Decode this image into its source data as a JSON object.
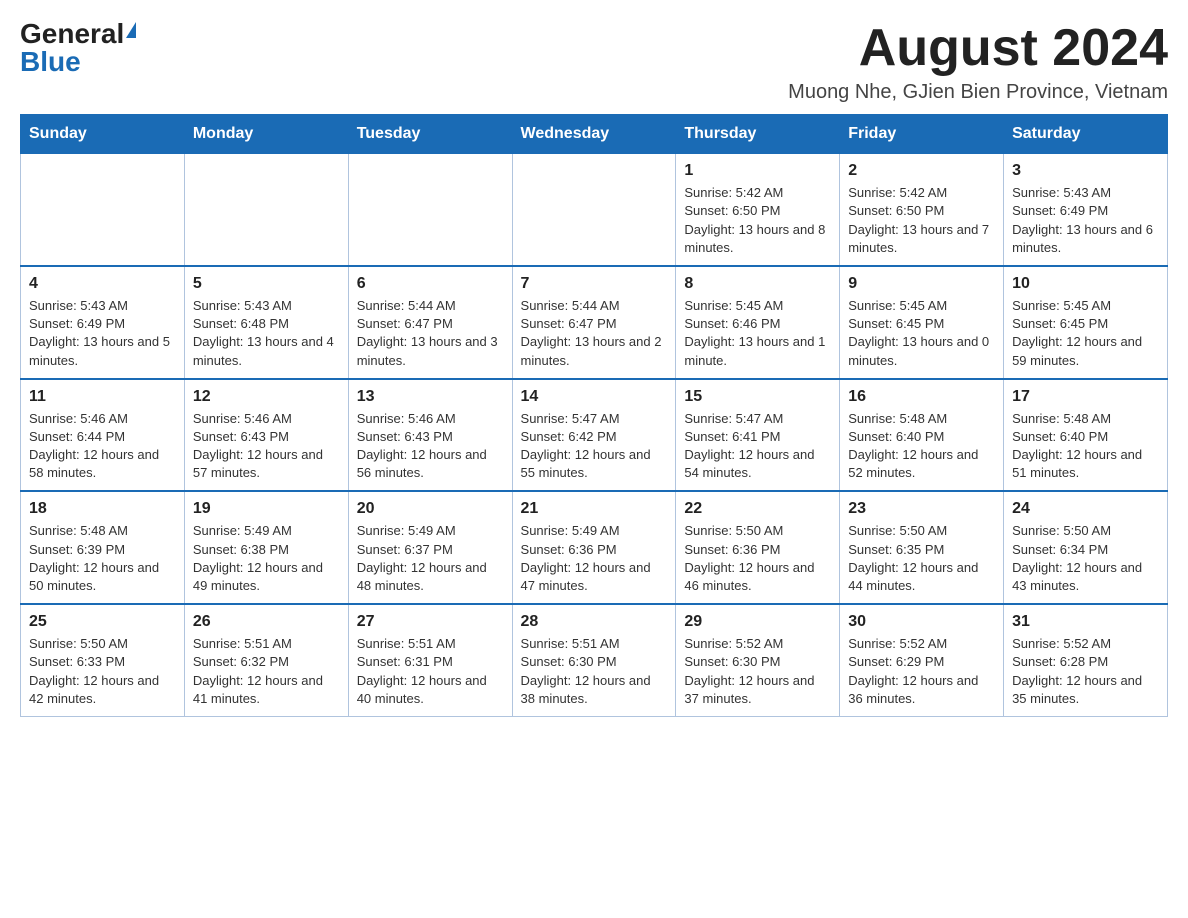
{
  "header": {
    "logo_general": "General",
    "logo_blue": "Blue",
    "month_title": "August 2024",
    "location": "Muong Nhe, GJien Bien Province, Vietnam"
  },
  "days_of_week": [
    "Sunday",
    "Monday",
    "Tuesday",
    "Wednesday",
    "Thursday",
    "Friday",
    "Saturday"
  ],
  "weeks": [
    [
      {
        "day": "",
        "info": ""
      },
      {
        "day": "",
        "info": ""
      },
      {
        "day": "",
        "info": ""
      },
      {
        "day": "",
        "info": ""
      },
      {
        "day": "1",
        "info": "Sunrise: 5:42 AM\nSunset: 6:50 PM\nDaylight: 13 hours and 8 minutes."
      },
      {
        "day": "2",
        "info": "Sunrise: 5:42 AM\nSunset: 6:50 PM\nDaylight: 13 hours and 7 minutes."
      },
      {
        "day": "3",
        "info": "Sunrise: 5:43 AM\nSunset: 6:49 PM\nDaylight: 13 hours and 6 minutes."
      }
    ],
    [
      {
        "day": "4",
        "info": "Sunrise: 5:43 AM\nSunset: 6:49 PM\nDaylight: 13 hours and 5 minutes."
      },
      {
        "day": "5",
        "info": "Sunrise: 5:43 AM\nSunset: 6:48 PM\nDaylight: 13 hours and 4 minutes."
      },
      {
        "day": "6",
        "info": "Sunrise: 5:44 AM\nSunset: 6:47 PM\nDaylight: 13 hours and 3 minutes."
      },
      {
        "day": "7",
        "info": "Sunrise: 5:44 AM\nSunset: 6:47 PM\nDaylight: 13 hours and 2 minutes."
      },
      {
        "day": "8",
        "info": "Sunrise: 5:45 AM\nSunset: 6:46 PM\nDaylight: 13 hours and 1 minute."
      },
      {
        "day": "9",
        "info": "Sunrise: 5:45 AM\nSunset: 6:45 PM\nDaylight: 13 hours and 0 minutes."
      },
      {
        "day": "10",
        "info": "Sunrise: 5:45 AM\nSunset: 6:45 PM\nDaylight: 12 hours and 59 minutes."
      }
    ],
    [
      {
        "day": "11",
        "info": "Sunrise: 5:46 AM\nSunset: 6:44 PM\nDaylight: 12 hours and 58 minutes."
      },
      {
        "day": "12",
        "info": "Sunrise: 5:46 AM\nSunset: 6:43 PM\nDaylight: 12 hours and 57 minutes."
      },
      {
        "day": "13",
        "info": "Sunrise: 5:46 AM\nSunset: 6:43 PM\nDaylight: 12 hours and 56 minutes."
      },
      {
        "day": "14",
        "info": "Sunrise: 5:47 AM\nSunset: 6:42 PM\nDaylight: 12 hours and 55 minutes."
      },
      {
        "day": "15",
        "info": "Sunrise: 5:47 AM\nSunset: 6:41 PM\nDaylight: 12 hours and 54 minutes."
      },
      {
        "day": "16",
        "info": "Sunrise: 5:48 AM\nSunset: 6:40 PM\nDaylight: 12 hours and 52 minutes."
      },
      {
        "day": "17",
        "info": "Sunrise: 5:48 AM\nSunset: 6:40 PM\nDaylight: 12 hours and 51 minutes."
      }
    ],
    [
      {
        "day": "18",
        "info": "Sunrise: 5:48 AM\nSunset: 6:39 PM\nDaylight: 12 hours and 50 minutes."
      },
      {
        "day": "19",
        "info": "Sunrise: 5:49 AM\nSunset: 6:38 PM\nDaylight: 12 hours and 49 minutes."
      },
      {
        "day": "20",
        "info": "Sunrise: 5:49 AM\nSunset: 6:37 PM\nDaylight: 12 hours and 48 minutes."
      },
      {
        "day": "21",
        "info": "Sunrise: 5:49 AM\nSunset: 6:36 PM\nDaylight: 12 hours and 47 minutes."
      },
      {
        "day": "22",
        "info": "Sunrise: 5:50 AM\nSunset: 6:36 PM\nDaylight: 12 hours and 46 minutes."
      },
      {
        "day": "23",
        "info": "Sunrise: 5:50 AM\nSunset: 6:35 PM\nDaylight: 12 hours and 44 minutes."
      },
      {
        "day": "24",
        "info": "Sunrise: 5:50 AM\nSunset: 6:34 PM\nDaylight: 12 hours and 43 minutes."
      }
    ],
    [
      {
        "day": "25",
        "info": "Sunrise: 5:50 AM\nSunset: 6:33 PM\nDaylight: 12 hours and 42 minutes."
      },
      {
        "day": "26",
        "info": "Sunrise: 5:51 AM\nSunset: 6:32 PM\nDaylight: 12 hours and 41 minutes."
      },
      {
        "day": "27",
        "info": "Sunrise: 5:51 AM\nSunset: 6:31 PM\nDaylight: 12 hours and 40 minutes."
      },
      {
        "day": "28",
        "info": "Sunrise: 5:51 AM\nSunset: 6:30 PM\nDaylight: 12 hours and 38 minutes."
      },
      {
        "day": "29",
        "info": "Sunrise: 5:52 AM\nSunset: 6:30 PM\nDaylight: 12 hours and 37 minutes."
      },
      {
        "day": "30",
        "info": "Sunrise: 5:52 AM\nSunset: 6:29 PM\nDaylight: 12 hours and 36 minutes."
      },
      {
        "day": "31",
        "info": "Sunrise: 5:52 AM\nSunset: 6:28 PM\nDaylight: 12 hours and 35 minutes."
      }
    ]
  ]
}
